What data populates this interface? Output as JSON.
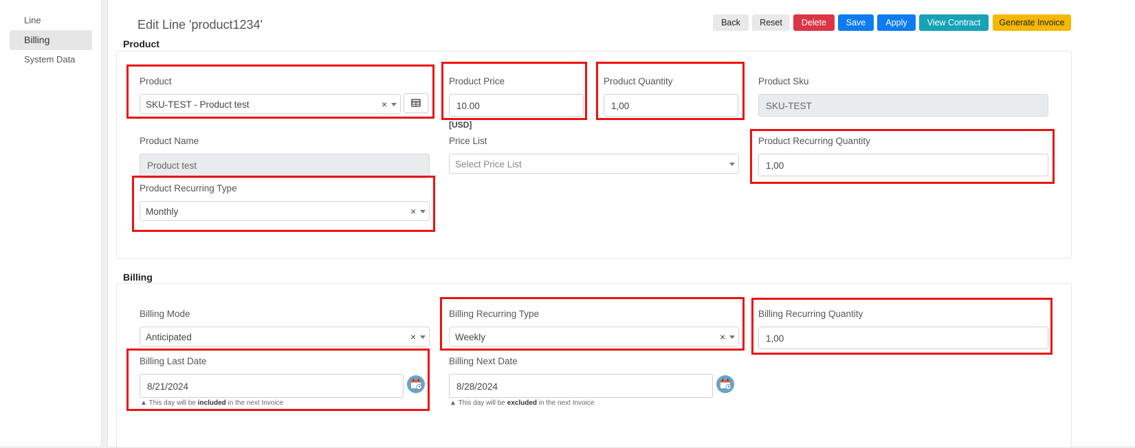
{
  "sidebar": {
    "items": [
      {
        "label": "Line"
      },
      {
        "label": "Billing"
      },
      {
        "label": "System Data"
      }
    ]
  },
  "header": {
    "title": "Edit Line 'product1234'",
    "buttons": {
      "back": "Back",
      "reset": "Reset",
      "delete": "Delete",
      "save": "Save",
      "apply": "Apply",
      "view_contract": "View Contract",
      "generate_invoice": "Generate Invoice"
    }
  },
  "product_section": {
    "title": "Product",
    "product": {
      "label": "Product",
      "value": "SKU-TEST - Product test"
    },
    "price": {
      "label": "Product Price",
      "value": "10.00",
      "currency": "[USD]"
    },
    "quantity": {
      "label": "Product Quantity",
      "value": "1,00"
    },
    "sku": {
      "label": "Product Sku",
      "value": "SKU-TEST"
    },
    "name": {
      "label": "Product Name",
      "value": "Product test"
    },
    "price_list": {
      "label": "Price List",
      "placeholder": "Select Price List"
    },
    "recurring_quantity": {
      "label": "Product Recurring Quantity",
      "value": "1,00"
    },
    "recurring_type": {
      "label": "Product Recurring Type",
      "value": "Monthly"
    }
  },
  "billing_section": {
    "title": "Billing",
    "mode": {
      "label": "Billing Mode",
      "value": "Anticipated"
    },
    "recurring_type": {
      "label": "Billing Recurring Type",
      "value": "Weekly"
    },
    "recurring_quantity": {
      "label": "Billing Recurring Quantity",
      "value": "1,00"
    },
    "last_date": {
      "label": "Billing Last Date",
      "value": "8/21/2024",
      "hint_prefix": "This day will be",
      "hint_emph": "included",
      "hint_suffix": "in the next Invoice"
    },
    "next_date": {
      "label": "Billing Next Date",
      "value": "8/28/2024",
      "hint_prefix": "This day will be",
      "hint_emph": "excluded",
      "hint_suffix": "in the next Invoice"
    }
  },
  "colors": {
    "highlight": "#ee1111",
    "delete": "#dc3545",
    "primary": "#0d7cf2",
    "info": "#17a2b8",
    "warning": "#f5b800"
  },
  "icons": {
    "clear": "clear-x-icon",
    "caret": "chevron-down-icon",
    "table": "table-icon",
    "calendar": "calendar-icon"
  }
}
